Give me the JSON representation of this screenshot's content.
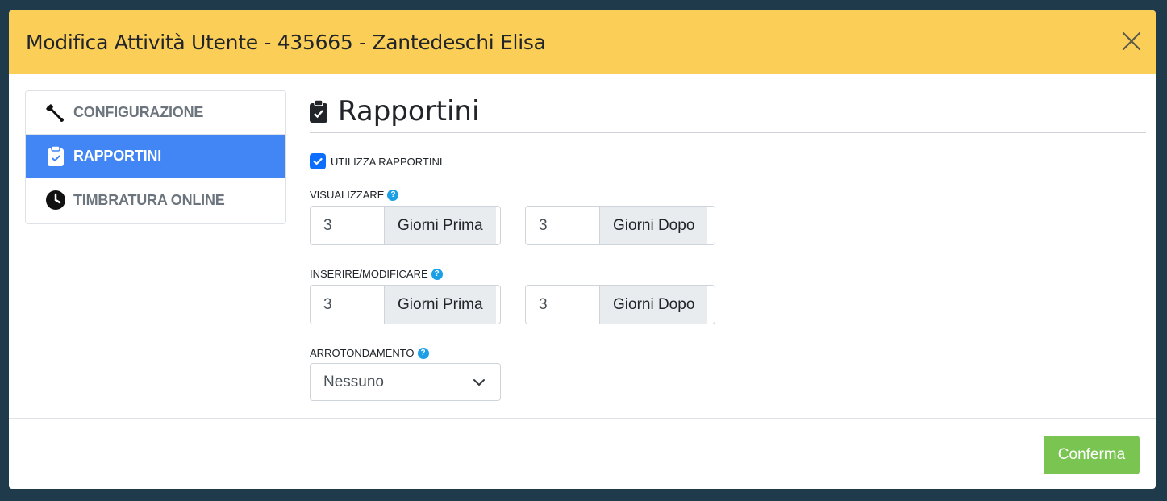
{
  "modal": {
    "title": "Modifica Attività Utente - 435665 - Zantedeschi Elisa"
  },
  "sidebar": {
    "items": [
      {
        "label": "CONFIGURAZIONE",
        "icon": "wrench-icon",
        "active": false
      },
      {
        "label": "RAPPORTINI",
        "icon": "clipboard-check-icon",
        "active": true
      },
      {
        "label": "TIMBRATURA ONLINE",
        "icon": "clock-icon",
        "active": false
      }
    ]
  },
  "section": {
    "title": "Rapportini",
    "use_checkbox_label": "UTILIZZA RAPPORTINI",
    "use_checked": true
  },
  "visualizzare": {
    "label": "VISUALIZZARE",
    "before_value": "3",
    "before_addon": "Giorni Prima",
    "after_value": "3",
    "after_addon": "Giorni Dopo"
  },
  "inserire": {
    "label": "INSERIRE/MODIFICARE",
    "before_value": "3",
    "before_addon": "Giorni Prima",
    "after_value": "3",
    "after_addon": "Giorni Dopo"
  },
  "arrotondamento": {
    "label": "ARROTONDAMENTO",
    "selected": "Nessuno"
  },
  "help_glyph": "?",
  "footer": {
    "confirm_label": "Conferma"
  },
  "colors": {
    "header": "#fbcf57",
    "active": "#4285f4",
    "confirm": "#7ac551",
    "help": "#1ba0e6"
  }
}
